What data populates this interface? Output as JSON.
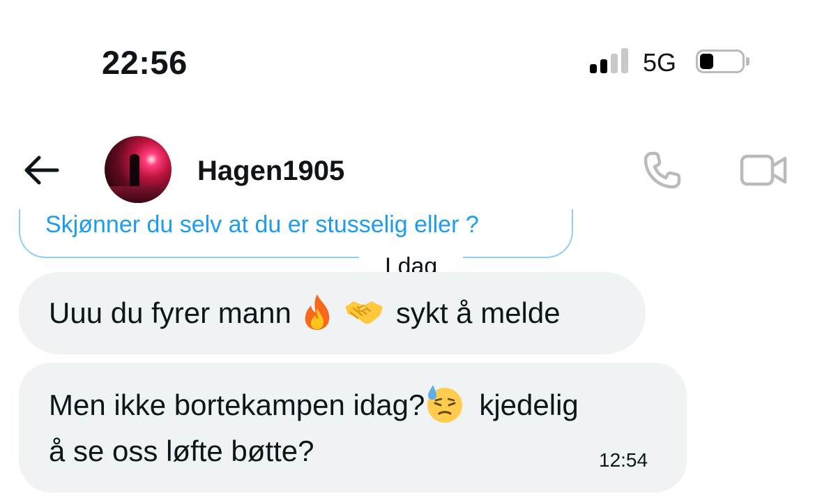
{
  "status_bar": {
    "time": "22:56",
    "network": "5G",
    "signal_bars_active": 2,
    "signal_bars_total": 4,
    "battery_level": 0.2
  },
  "header": {
    "back_icon": "arrow-left-icon",
    "contact_name": "Hagen1905",
    "call_icon": "phone-icon",
    "video_icon": "video-camera-icon"
  },
  "conversation": {
    "quoted_message": "Skjønner du selv at du er stusselig eller ?",
    "date_divider": "I dag",
    "messages": [
      {
        "parts": [
          "Uuu du fyrer mann",
          "sykt å melde"
        ],
        "emojis": [
          "fire-emoji",
          "handshake-emoji"
        ]
      },
      {
        "line1": [
          "Men ikke bortekampen idag?",
          "kjedelig"
        ],
        "line2": "å se oss løfte bøtte?",
        "emojis": [
          "downcast-face-with-sweat-emoji"
        ],
        "time": "12:54"
      }
    ]
  },
  "colors": {
    "accent": "#1d9bf0",
    "bubble_bg": "#eff3f4",
    "text": "#0f1419",
    "icon_gray": "#b9b9be"
  }
}
